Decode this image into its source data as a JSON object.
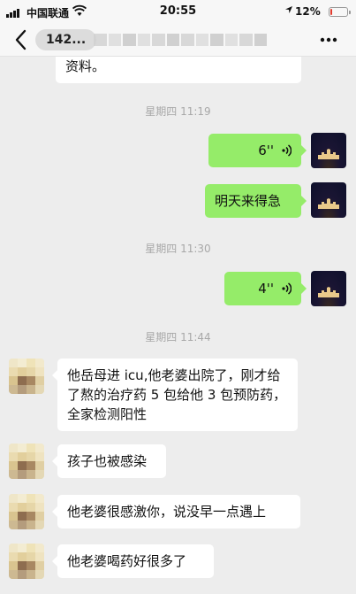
{
  "status_bar": {
    "carrier": "中国联通",
    "time": "20:55",
    "battery_text": "12%",
    "battery_level": 0.12,
    "battery_color": "#e23b2e"
  },
  "nav": {
    "back_icon": "chevron-left-icon",
    "count_label": "142...",
    "more_icon": "more-dots-icon"
  },
  "messages": {
    "prev_text": "资料。",
    "ts1": "星期四 11:19",
    "voice1_duration": "6''",
    "text1": "明天来得急",
    "ts2": "星期四 11:30",
    "voice2_duration": "4''",
    "ts3": "星期四 11:44",
    "friend1": "他岳母进 icu,他老婆出院了，刚才给了熬的治疗药 5 包给他 3 包预防药，全家检测阳性",
    "friend2": "孩子也被感染",
    "friend3": "他老婆很感激你，说没早一点遇上",
    "friend4": "他老婆喝药好很多了"
  },
  "colors": {
    "outgoing_bubble": "#95ec69",
    "incoming_bubble": "#ffffff",
    "background": "#ededed"
  }
}
